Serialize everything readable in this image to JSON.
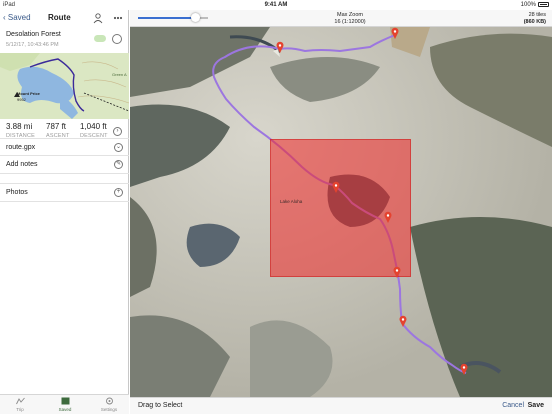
{
  "status_bar": {
    "device": "iPad",
    "time": "9:41 AM",
    "battery": "100%"
  },
  "nav": {
    "back_label": "Saved",
    "title": "Route"
  },
  "route": {
    "name": "Desolation Forest",
    "date": "5/12/17, 10:43:46 PM",
    "thumb_labels": {
      "creek": "Green A",
      "peak": "Mount Price",
      "elev": "9952"
    }
  },
  "stats": [
    {
      "value": "3.88 mi",
      "label": "DISTANCE"
    },
    {
      "value": "787 ft",
      "label": "ASCENT"
    },
    {
      "value": "1,040 ft",
      "label": "DESCENT"
    }
  ],
  "rows": {
    "file": "route.gpx",
    "notes": "Add notes",
    "photos": "Photos"
  },
  "tabs": [
    {
      "label": "Trip",
      "icon": "trip-icon"
    },
    {
      "label": "Saved",
      "icon": "saved-icon"
    },
    {
      "label": "Settings",
      "icon": "settings-icon"
    }
  ],
  "download": {
    "max_zoom_label": "Max Zoom",
    "max_zoom_value": "16 (1:12000)",
    "tiles": "28 tiles",
    "size": "(860 KB)",
    "zoom_fraction": 0.82
  },
  "map": {
    "lake_label": "Lake Aloha"
  },
  "bottom": {
    "hint": "Drag to Select",
    "cancel": "Cancel",
    "save": "Save"
  },
  "colors": {
    "accent": "#3a5a8a",
    "route": "#7b4fc8",
    "selection": "#f02828",
    "marker": "#e4432f"
  }
}
